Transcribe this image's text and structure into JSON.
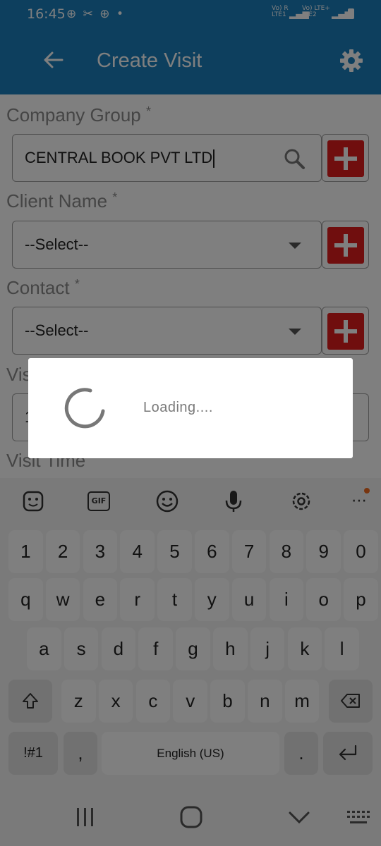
{
  "status": {
    "time": "16:45",
    "icons": "⊕ ✂ ⊕ •",
    "network1": "Vo) R\nLTE1",
    "network2": "Vo) LTE+\nLTE2"
  },
  "appbar": {
    "title": "Create Visit"
  },
  "form": {
    "company_group": {
      "label": "Company Group",
      "required": "*",
      "value": "CENTRAL BOOK PVT LTD"
    },
    "client_name": {
      "label": "Client Name",
      "required": "*",
      "value": "--Select--"
    },
    "contact": {
      "label": "Contact",
      "required": "*",
      "value": "--Select--"
    },
    "visit_date_label": "Vis",
    "visit_date_value": "1",
    "visit_time_label": "Visit Time"
  },
  "dialog": {
    "text": "Loading...."
  },
  "keyboard": {
    "toolbar": [
      "sticker-icon",
      "gif-icon",
      "emoji-icon",
      "mic-icon",
      "settings-icon",
      "more-icon"
    ],
    "gif_label": "GIF",
    "row_numbers": [
      "1",
      "2",
      "3",
      "4",
      "5",
      "6",
      "7",
      "8",
      "9",
      "0"
    ],
    "row1": [
      "q",
      "w",
      "e",
      "r",
      "t",
      "y",
      "u",
      "i",
      "o",
      "p"
    ],
    "row2": [
      "a",
      "s",
      "d",
      "f",
      "g",
      "h",
      "j",
      "k",
      "l"
    ],
    "row3": [
      "z",
      "x",
      "c",
      "v",
      "b",
      "n",
      "m"
    ],
    "symbols": "!#1",
    "comma": ",",
    "space": "English (US)",
    "period": "."
  },
  "colors": {
    "appbar": "#1a7fbd",
    "add_button": "#e01d1d"
  }
}
